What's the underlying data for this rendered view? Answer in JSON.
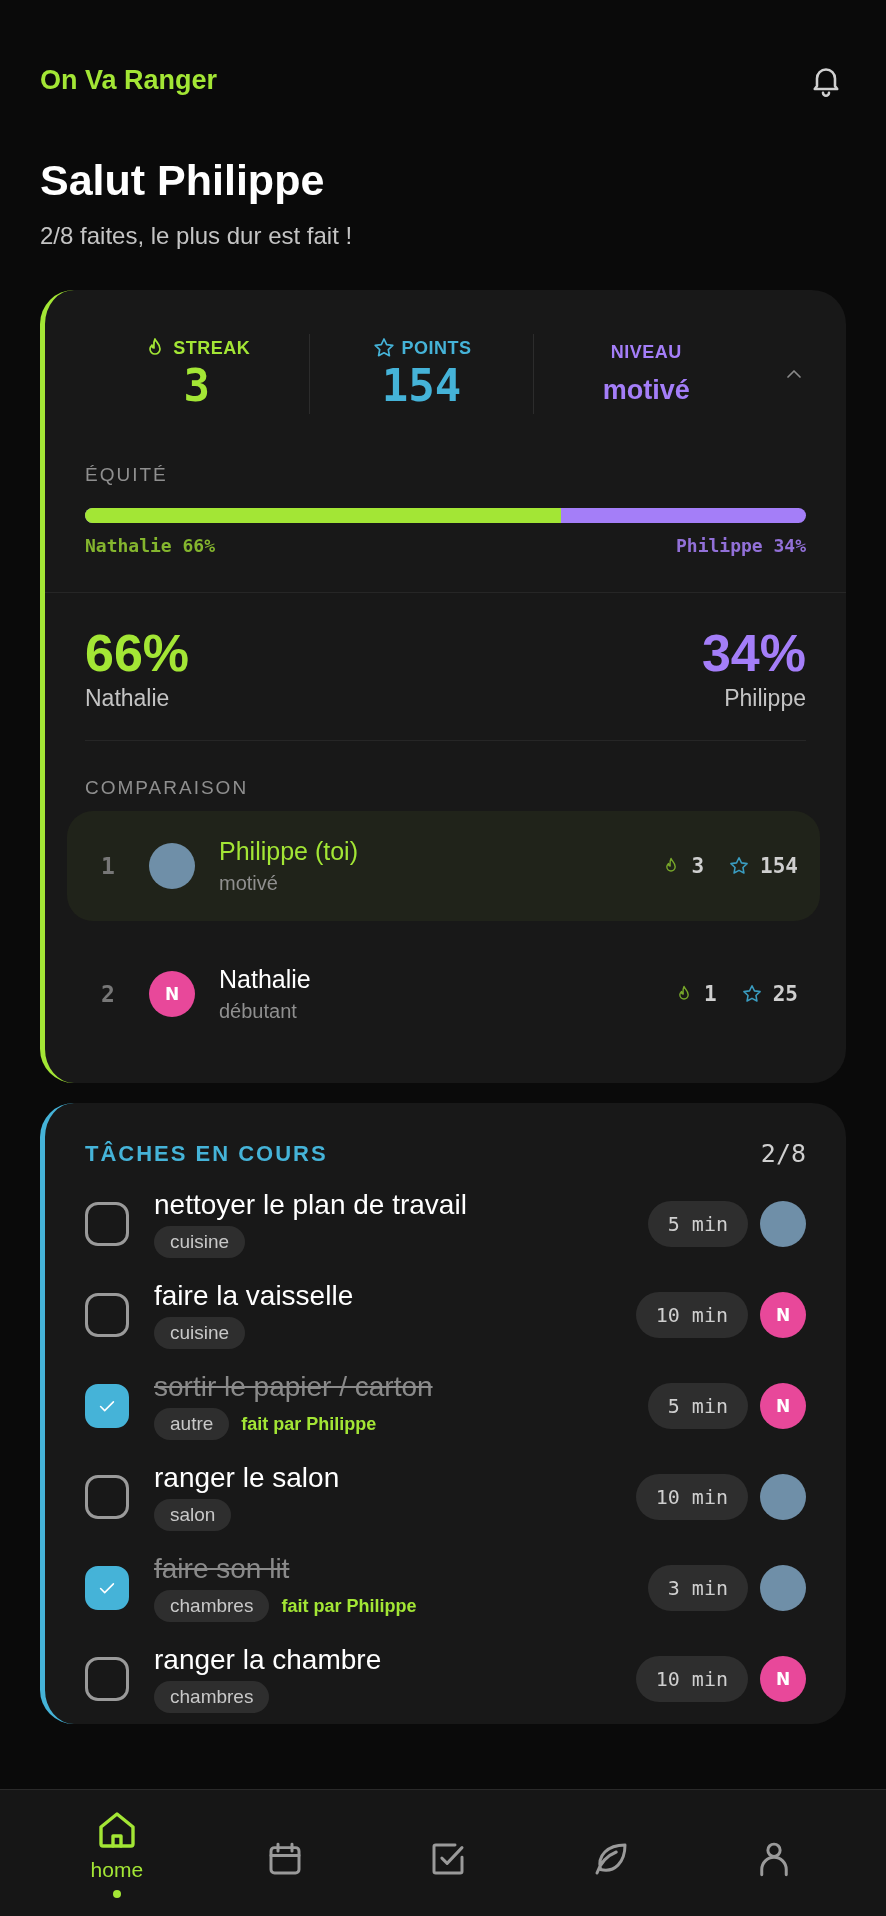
{
  "header": {
    "app_name": "On Va Ranger"
  },
  "greeting": {
    "title": "Salut Philippe",
    "subtitle": "2/8 faites, le plus dur est fait !"
  },
  "stats": {
    "streak": {
      "label": "STREAK",
      "value": "3"
    },
    "points": {
      "label": "POINTS",
      "value": "154"
    },
    "level": {
      "label": "NIVEAU",
      "value": "motivé"
    },
    "expanded": true
  },
  "equity": {
    "label": "ÉQUITÉ",
    "level": 0.66,
    "left_label": "Nathalie 66%",
    "right_label": "Philippe 34%"
  },
  "shares": [
    {
      "percent": "66%",
      "name": "Nathalie",
      "kind": "left"
    },
    {
      "percent": "34%",
      "name": "Philippe",
      "kind": "right"
    }
  ],
  "comparison": {
    "label": "COMPARAISON",
    "rows": [
      {
        "rank": "1",
        "name": "Philippe (toi)",
        "level": "motivé",
        "streak": "3",
        "points": "154",
        "selected": true,
        "avatar": {
          "kind": "photo"
        }
      },
      {
        "rank": "2",
        "name": "Nathalie",
        "level": "débutant",
        "streak": "1",
        "points": "25",
        "selected": false,
        "avatar": {
          "kind": "initial",
          "text": "N"
        }
      }
    ]
  },
  "tasks": {
    "title": "TÂCHES EN COURS",
    "count": "2/8",
    "items": [
      {
        "title": "nettoyer le plan de travail",
        "tag": "cuisine",
        "time": "5 min",
        "checked": false,
        "avatar": {
          "kind": "photo"
        }
      },
      {
        "title": "faire la vaisselle",
        "tag": "cuisine",
        "time": "10 min",
        "checked": false,
        "avatar": {
          "kind": "initial",
          "text": "N"
        }
      },
      {
        "title": "sortir le papier / carton",
        "tag": "autre",
        "done_by": "fait par Philippe",
        "time": "5 min",
        "checked": true,
        "avatar": {
          "kind": "initial",
          "text": "N"
        }
      },
      {
        "title": "ranger le salon",
        "tag": "salon",
        "time": "10 min",
        "checked": false,
        "avatar": {
          "kind": "photo"
        }
      },
      {
        "title": "faire son lit",
        "tag": "chambres",
        "done_by": "fait par Philippe",
        "time": "3 min",
        "checked": true,
        "avatar": {
          "kind": "photo"
        }
      },
      {
        "title": "ranger la chambre",
        "tag": "chambres",
        "time": "10 min",
        "checked": false,
        "avatar": {
          "kind": "initial",
          "text": "N"
        }
      }
    ]
  },
  "nav": [
    {
      "kind": "home",
      "label": "home",
      "selected": true
    },
    {
      "kind": "calendar",
      "selected": false
    },
    {
      "kind": "check",
      "selected": false
    },
    {
      "kind": "leaf",
      "selected": false
    },
    {
      "kind": "user",
      "selected": false
    }
  ]
}
